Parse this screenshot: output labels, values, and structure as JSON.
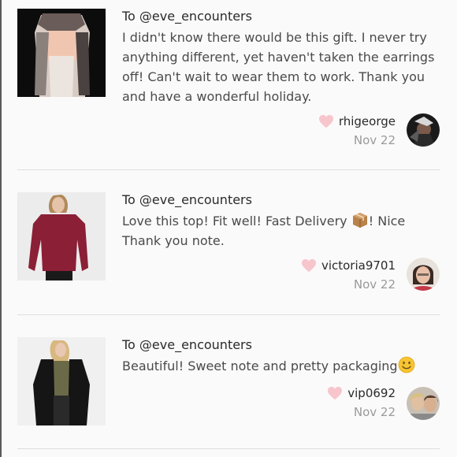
{
  "reviews": [
    {
      "to": "To @eve_encounters",
      "message": "I didn't know there would be this gift. I never try anything different, yet haven't taken the earrings off! Can't wait to wear them to work. Thank you and have a wonderful holiday.",
      "username": "rhigeorge",
      "date": "Nov 22"
    },
    {
      "to": "To @eve_encounters",
      "message_before": "Love this top! Fit well! Fast Delivery ",
      "message_after": "! Nice Thank you note.",
      "username": "victoria9701",
      "date": "Nov 22"
    },
    {
      "to": "To @eve_encounters",
      "message_before": "Beautiful! Sweet note and pretty packaging",
      "username": "vip0692",
      "date": "Nov 22"
    }
  ],
  "icons": {
    "heart": "heart-icon",
    "package": "package-emoji",
    "smile": "smile-emoji"
  },
  "colors": {
    "heart": "#f7c6cc",
    "divider": "#dedede",
    "date": "#9a9a9a"
  }
}
